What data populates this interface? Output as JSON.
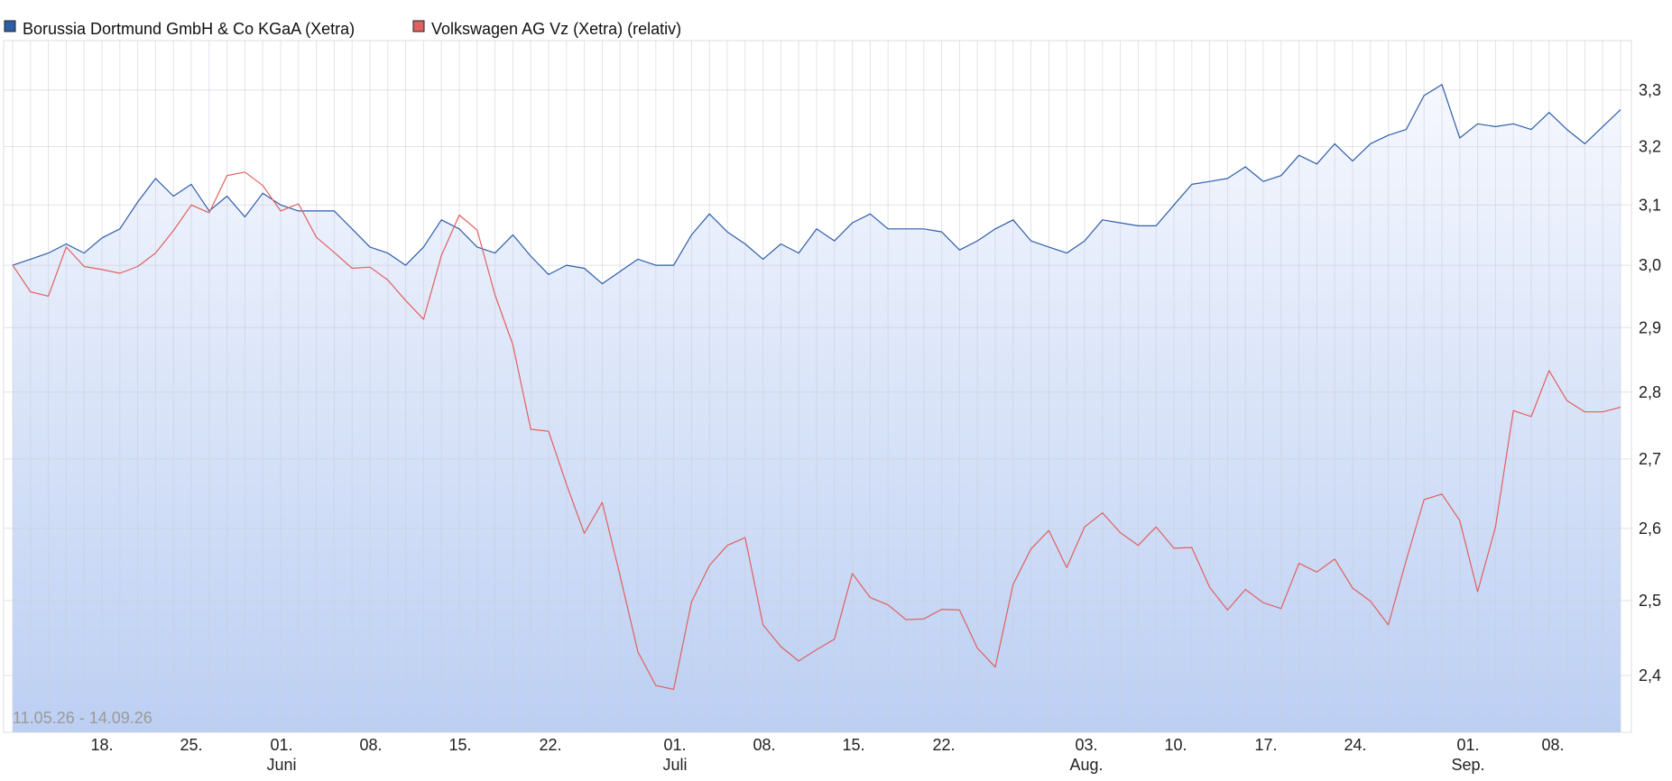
{
  "chart_data": {
    "type": "line",
    "date_range": "11.05.26 - 14.09.26",
    "legend_placement": "top-left",
    "grid": true,
    "x_ticks": [
      {
        "day": "18.",
        "month": ""
      },
      {
        "day": "25.",
        "month": ""
      },
      {
        "day": "01.",
        "month": "Juni"
      },
      {
        "day": "08.",
        "month": ""
      },
      {
        "day": "15.",
        "month": ""
      },
      {
        "day": "22.",
        "month": ""
      },
      {
        "day": "01.",
        "month": "Juli"
      },
      {
        "day": "08.",
        "month": ""
      },
      {
        "day": "15.",
        "month": ""
      },
      {
        "day": "22.",
        "month": ""
      },
      {
        "day": "03.",
        "month": "Aug."
      },
      {
        "day": "10.",
        "month": ""
      },
      {
        "day": "17.",
        "month": ""
      },
      {
        "day": "24.",
        "month": ""
      },
      {
        "day": "01.",
        "month": "Sep."
      },
      {
        "day": "08.",
        "month": ""
      }
    ],
    "y_axis": {
      "scale": "log",
      "ticks": [
        "3,3",
        "3,2",
        "3,1",
        "3,0",
        "2,9",
        "2,8",
        "2,7",
        "2,6",
        "2,5",
        "2,4"
      ],
      "range": [
        2.327,
        3.39
      ]
    },
    "series": [
      {
        "name": "Borussia Dortmund GmbH & Co KGaA (Xetra)",
        "color": "#2e5ea8",
        "values": [
          3.0,
          3.01,
          3.02,
          3.035,
          3.02,
          3.045,
          3.06,
          3.105,
          3.145,
          3.115,
          3.135,
          3.09,
          3.115,
          3.08,
          3.12,
          3.1,
          3.09,
          3.09,
          3.09,
          3.06,
          3.03,
          3.02,
          3.0,
          3.03,
          3.075,
          3.06,
          3.03,
          3.02,
          3.05,
          3.015,
          2.985,
          3.0,
          2.995,
          2.97,
          2.99,
          3.01,
          3.0,
          3.0,
          3.05,
          3.085,
          3.055,
          3.035,
          3.01,
          3.035,
          3.02,
          3.06,
          3.04,
          3.07,
          3.085,
          3.06,
          3.06,
          3.06,
          3.055,
          3.025,
          3.04,
          3.06,
          3.075,
          3.04,
          3.03,
          3.02,
          3.04,
          3.075,
          3.07,
          3.065,
          3.065,
          3.1,
          3.135,
          3.14,
          3.145,
          3.165,
          3.14,
          3.15,
          3.185,
          3.17,
          3.205,
          3.175,
          3.205,
          3.22,
          3.23,
          3.29,
          3.31,
          3.215,
          3.24,
          3.235,
          3.24,
          3.23,
          3.26,
          3.23,
          3.205,
          3.235,
          3.265
        ]
      },
      {
        "name": "Volkswagen AG Vz (Xetra) (relativ)",
        "color": "#e06060",
        "values": [
          3.0,
          2.957,
          2.95,
          3.03,
          2.998,
          2.993,
          2.987,
          2.998,
          3.02,
          3.057,
          3.1,
          3.087,
          3.15,
          3.156,
          3.133,
          3.09,
          3.102,
          3.046,
          3.021,
          2.995,
          2.997,
          2.976,
          2.943,
          2.913,
          3.016,
          3.083,
          3.058,
          2.952,
          2.873,
          2.744,
          2.741,
          2.663,
          2.593,
          2.637,
          2.534,
          2.431,
          2.387,
          2.382,
          2.498,
          2.548,
          2.576,
          2.587,
          2.467,
          2.438,
          2.419,
          2.434,
          2.448,
          2.537,
          2.504,
          2.494,
          2.474,
          2.475,
          2.488,
          2.487,
          2.436,
          2.411,
          2.522,
          2.571,
          2.597,
          2.545,
          2.602,
          2.622,
          2.594,
          2.576,
          2.602,
          2.572,
          2.573,
          2.518,
          2.487,
          2.515,
          2.497,
          2.489,
          2.551,
          2.539,
          2.557,
          2.517,
          2.499,
          2.467,
          2.555,
          2.641,
          2.649,
          2.611,
          2.512,
          2.602,
          2.772,
          2.763,
          2.833,
          2.787,
          2.77,
          2.77,
          2.777
        ]
      }
    ]
  }
}
